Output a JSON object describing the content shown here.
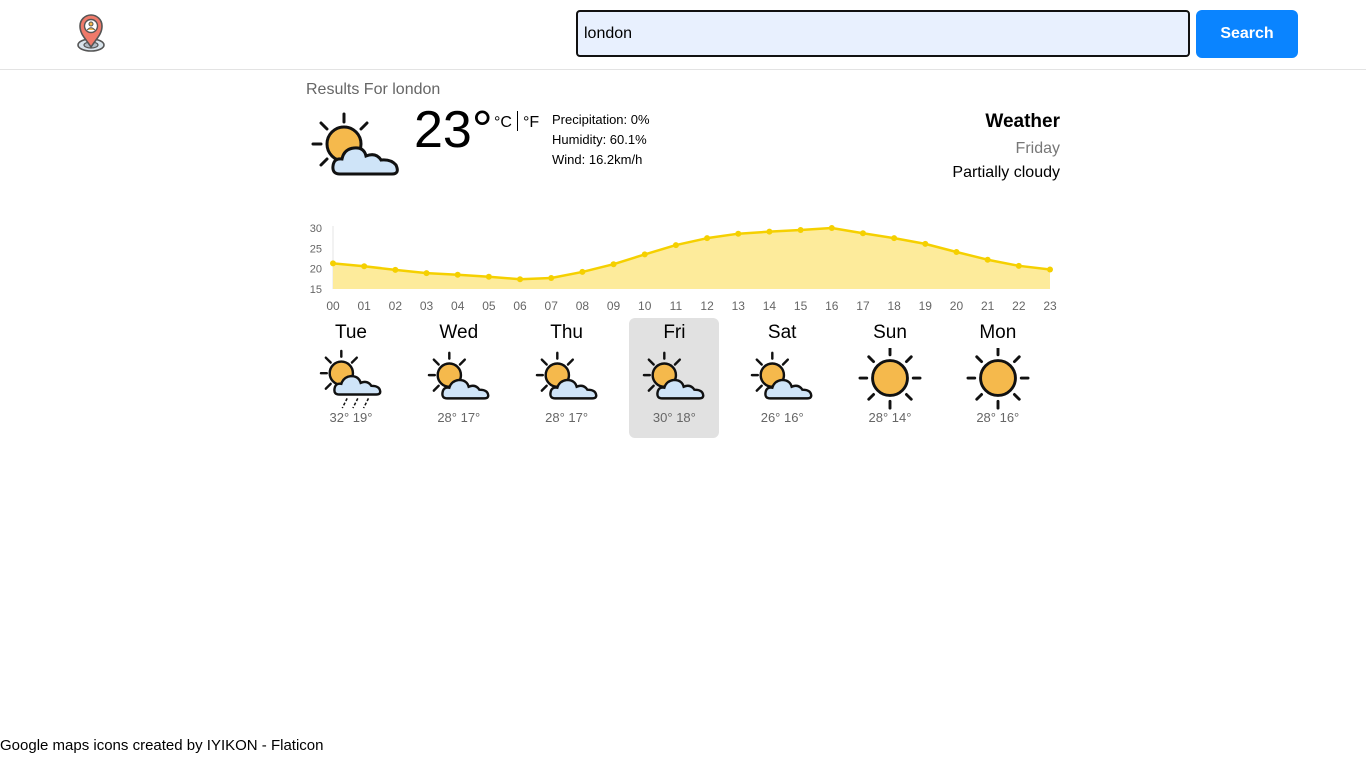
{
  "search": {
    "value": "london",
    "button_label": "Search"
  },
  "results": {
    "prefix": "Results For ",
    "query": "london"
  },
  "current": {
    "icon": "sun-cloud-icon",
    "temperature": "23°",
    "unit_c": "°C",
    "unit_f": "°F",
    "precipitation": "Precipitation: 0%",
    "humidity": "Humidity: 60.1%",
    "wind": "Wind: 16.2km/h"
  },
  "summary": {
    "title": "Weather",
    "day": "Friday",
    "condition": "Partially cloudy"
  },
  "chart_data": {
    "type": "area",
    "x": [
      "00",
      "01",
      "02",
      "03",
      "04",
      "05",
      "06",
      "07",
      "08",
      "09",
      "10",
      "11",
      "12",
      "13",
      "14",
      "15",
      "16",
      "17",
      "18",
      "19",
      "20",
      "21",
      "22",
      "23"
    ],
    "series": [
      {
        "values": [
          21.3,
          20.6,
          19.7,
          18.9,
          18.5,
          18.0,
          17.4,
          17.7,
          19.2,
          21.1,
          23.5,
          25.8,
          27.5,
          28.6,
          29.1,
          29.5,
          30.0,
          28.7,
          27.5,
          26.1,
          24.1,
          22.2,
          20.7,
          19.8
        ]
      }
    ],
    "yticks": [
      "30",
      "25",
      "20",
      "15"
    ],
    "ylim": [
      15,
      30
    ],
    "grid": false,
    "colors": {
      "line": "#f5d000",
      "fill": "#fdeb9b"
    }
  },
  "forecast": [
    {
      "day": "Tue",
      "icon": "sun-cloud-rain-icon",
      "range": "32° 19°",
      "active": false
    },
    {
      "day": "Wed",
      "icon": "sun-cloud-icon",
      "range": "28° 17°",
      "active": false
    },
    {
      "day": "Thu",
      "icon": "sun-cloud-icon",
      "range": "28° 17°",
      "active": false
    },
    {
      "day": "Fri",
      "icon": "sun-cloud-icon",
      "range": "30° 18°",
      "active": true
    },
    {
      "day": "Sat",
      "icon": "sun-cloud-icon",
      "range": "26° 16°",
      "active": false
    },
    {
      "day": "Sun",
      "icon": "sun-icon",
      "range": "28° 14°",
      "active": false
    },
    {
      "day": "Mon",
      "icon": "sun-icon",
      "range": "28° 16°",
      "active": false
    }
  ],
  "footer": {
    "credit": "Google maps icons created by IYIKON - Flaticon"
  },
  "colors": {
    "accent": "#0a84ff",
    "input_bg": "#e8f0fe",
    "sun": "#f5b94c",
    "cloud": "#cfe4f8",
    "active_day": "#e1e1e1"
  }
}
